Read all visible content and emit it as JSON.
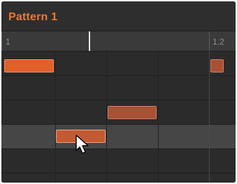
{
  "pattern": {
    "title": "Pattern 1"
  },
  "ruler": {
    "marks": [
      "1",
      "1.2"
    ]
  },
  "colors": {
    "accent": "#f07830",
    "note_bright": "#e0602a",
    "note_dim": "#a85134",
    "background": "#2c2c2c",
    "selected_row": "#464646"
  },
  "icons": {
    "cursor": "mouse-pointer-icon"
  }
}
